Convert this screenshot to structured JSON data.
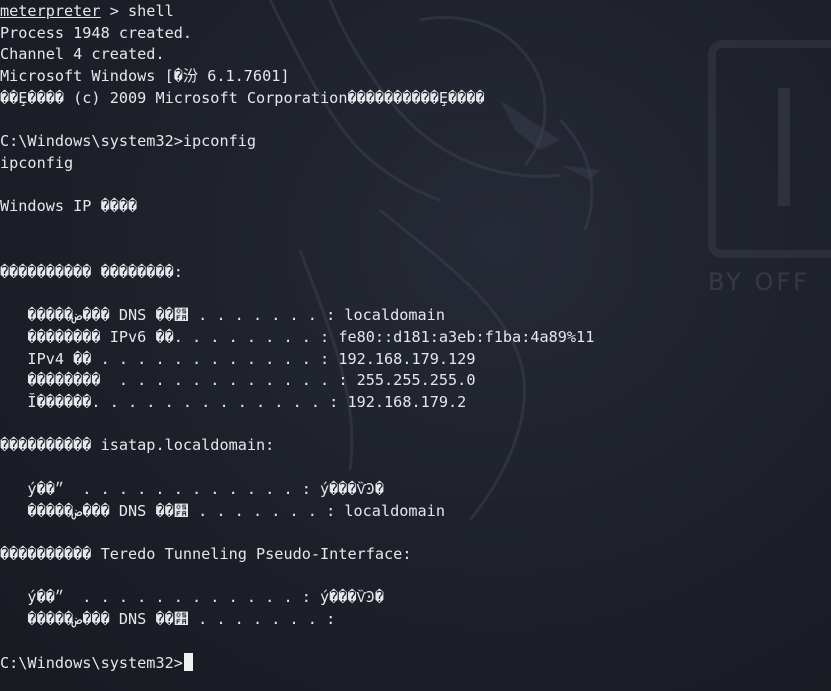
{
  "wallpaper": {
    "watermark_text": "BY OFF",
    "brand_icon": "kali-dragon-icon"
  },
  "terminal": {
    "prompt_user": "meterpreter",
    "prompt_cmd": " > shell",
    "lines": [
      "Process 1948 created.",
      "Channel 4 created.",
      "Microsoft Windows [�汾 6.1.7601]",
      "��Ȩ���� (c) 2009 Microsoft Corporation����������Ȩ����",
      "",
      "C:\\Windows\\system32>ipconfig",
      "ipconfig",
      "",
      "Windows IP ����",
      "",
      "",
      "���������� ��������:",
      "",
      "   �����ض��� DNS ��׺ . . . . . . . : localdomain",
      "   �������� IPv6 ��. . . . . . . . : fe80::d181:a3eb:f1ba:4a89%11",
      "   IPv4 �� . . . . . . . . . . . . : 192.168.179.129",
      "   ��������  . . . . . . . . . . . . : 255.255.255.0",
      "   Ĭ������. . . . . . . . . . . . . : 192.168.179.2",
      "",
      "���������� isatap.localdomain:",
      "",
      "   ý��״  . . . . . . . . . . . . : ý���ѶϿ�",
      "   �����ض��� DNS ��׺ . . . . . . . : localdomain",
      "",
      "���������� Teredo Tunneling Pseudo-Interface:",
      "",
      "   ý��״  . . . . . . . . . . . . : ý���ѶϿ�",
      "   �����ض��� DNS ��׺ . . . . . . . :",
      ""
    ],
    "final_prompt": "C:\\Windows\\system32>"
  }
}
